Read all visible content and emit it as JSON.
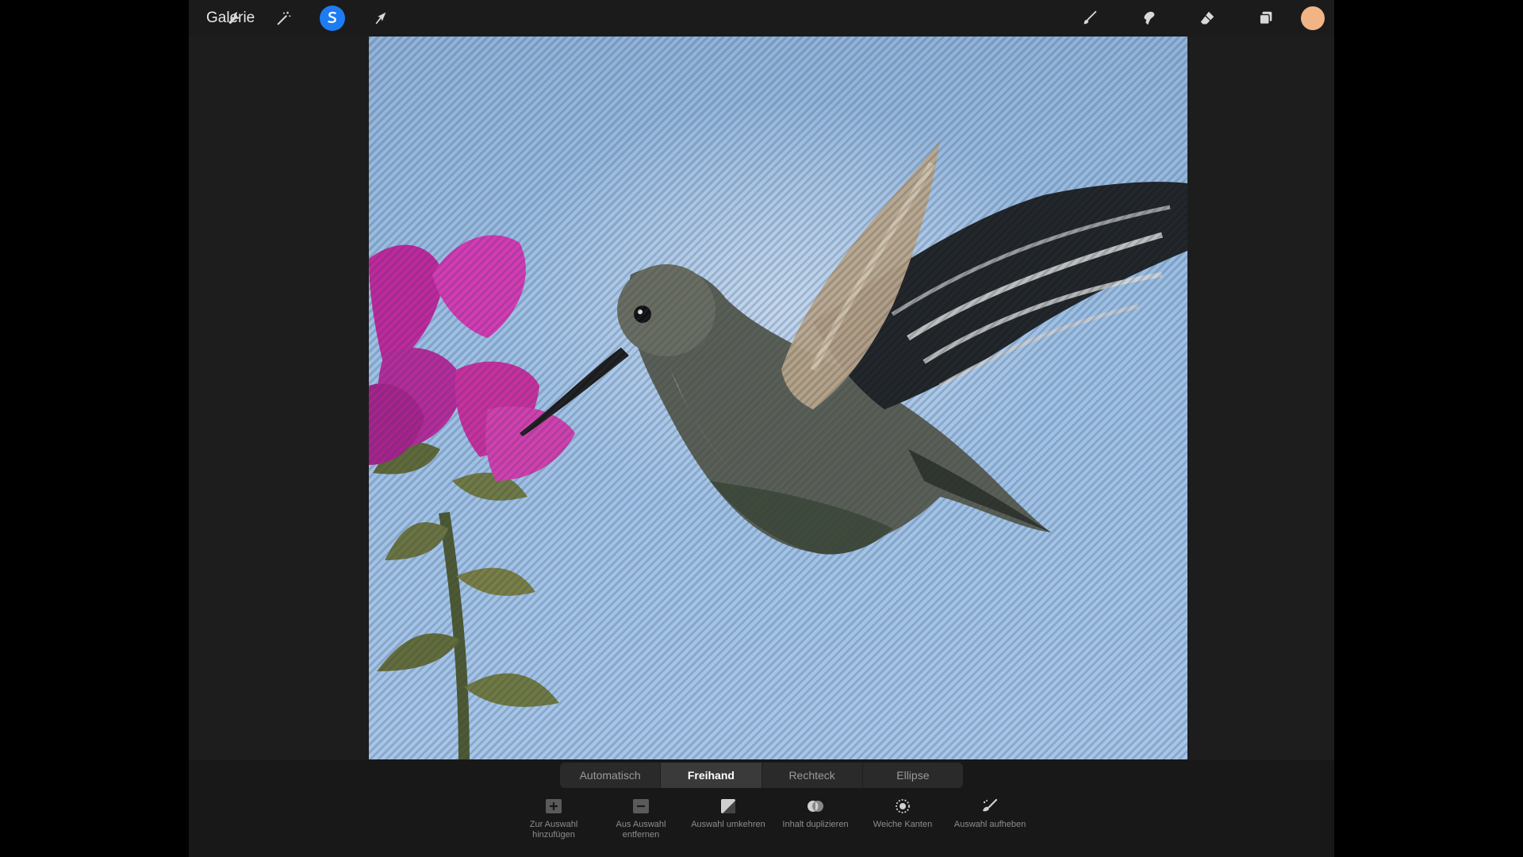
{
  "topbar": {
    "gallery_label": "Galerie",
    "left_tools": [
      {
        "icon": "wrench-icon",
        "name": "actions"
      },
      {
        "icon": "magic-wand-icon",
        "name": "adjustments"
      },
      {
        "icon": "selection-s-icon",
        "name": "selection",
        "active": true
      },
      {
        "icon": "arrow-cursor-icon",
        "name": "transform"
      }
    ],
    "right_tools": [
      {
        "icon": "brush-icon",
        "name": "paint"
      },
      {
        "icon": "smudge-icon",
        "name": "smudge"
      },
      {
        "icon": "eraser-icon",
        "name": "eraser"
      },
      {
        "icon": "layers-icon",
        "name": "layers"
      }
    ],
    "current_color": "#f1b485",
    "accent_color": "#1e7cf2"
  },
  "selection_modes": {
    "options": [
      "Automatisch",
      "Freihand",
      "Rechteck",
      "Ellipse"
    ],
    "selected": "Freihand"
  },
  "selection_actions": [
    {
      "label": "Zur Auswahl hinzufügen",
      "icon": "plus-box-icon"
    },
    {
      "label": "Aus Auswahl entfernen",
      "icon": "minus-box-icon"
    },
    {
      "label": "Auswahl umkehren",
      "icon": "invert-icon"
    },
    {
      "label": "Inhalt duplizieren",
      "icon": "duplicate-icon"
    },
    {
      "label": "Weiche Kanten",
      "icon": "feather-icon"
    },
    {
      "label": "Auswahl aufheben",
      "icon": "clear-selection-icon"
    }
  ]
}
